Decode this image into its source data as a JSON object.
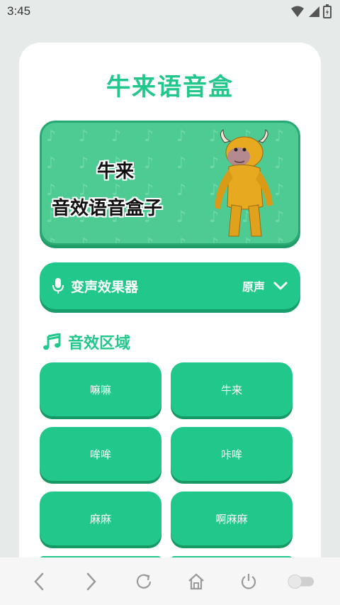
{
  "status_bar": {
    "time": "3:45"
  },
  "app": {
    "title": "牛来语音盒"
  },
  "banner": {
    "line1": "牛来",
    "line2": "音效语音盒子"
  },
  "voice_changer": {
    "label": "变声效果器",
    "value": "原声"
  },
  "section": {
    "title": "音效区域"
  },
  "sounds": [
    {
      "label": "嘛嘛"
    },
    {
      "label": "牛来"
    },
    {
      "label": "哞哞"
    },
    {
      "label": "咔哞"
    },
    {
      "label": "麻麻"
    },
    {
      "label": "啊麻麻"
    }
  ],
  "colors": {
    "accent": "#22c78b",
    "background": "#e6ebea"
  },
  "nav_icons": [
    "back-icon",
    "forward-icon",
    "refresh-icon",
    "home-icon",
    "power-icon",
    "toggle-icon"
  ]
}
